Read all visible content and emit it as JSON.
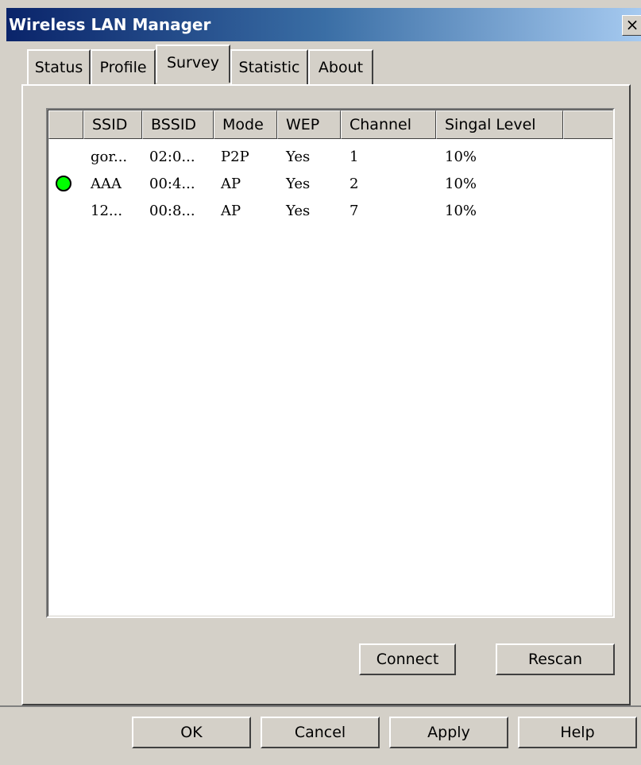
{
  "window": {
    "title": "Wireless LAN Manager",
    "close_label": "×"
  },
  "tabs": [
    {
      "label": "Status"
    },
    {
      "label": "Profile"
    },
    {
      "label": "Survey",
      "active": true
    },
    {
      "label": "Statistic"
    },
    {
      "label": "About"
    }
  ],
  "table": {
    "columns": [
      "",
      "SSID",
      "BSSID",
      "Mode",
      "WEP",
      "Channel",
      "Singal Level",
      ""
    ],
    "rows": [
      {
        "connected": false,
        "ssid": "gor...",
        "bssid": "02:0...",
        "mode": "P2P",
        "wep": "Yes",
        "channel": "1",
        "signal": "10%"
      },
      {
        "connected": true,
        "ssid": "AAA",
        "bssid": "00:4...",
        "mode": "AP",
        "wep": "Yes",
        "channel": "2",
        "signal": "10%"
      },
      {
        "connected": false,
        "ssid": "12...",
        "bssid": "00:8...",
        "mode": "AP",
        "wep": "Yes",
        "channel": "7",
        "signal": "10%"
      }
    ]
  },
  "survey_buttons": {
    "connect": "Connect",
    "rescan": "Rescan"
  },
  "dialog_buttons": {
    "ok": "OK",
    "cancel": "Cancel",
    "apply": "Apply",
    "help": "Help"
  },
  "colors": {
    "title_start": "#0a246a",
    "title_end": "#a6caf0",
    "connected_dot": "#00ff00",
    "face": "#d4d0c8"
  }
}
